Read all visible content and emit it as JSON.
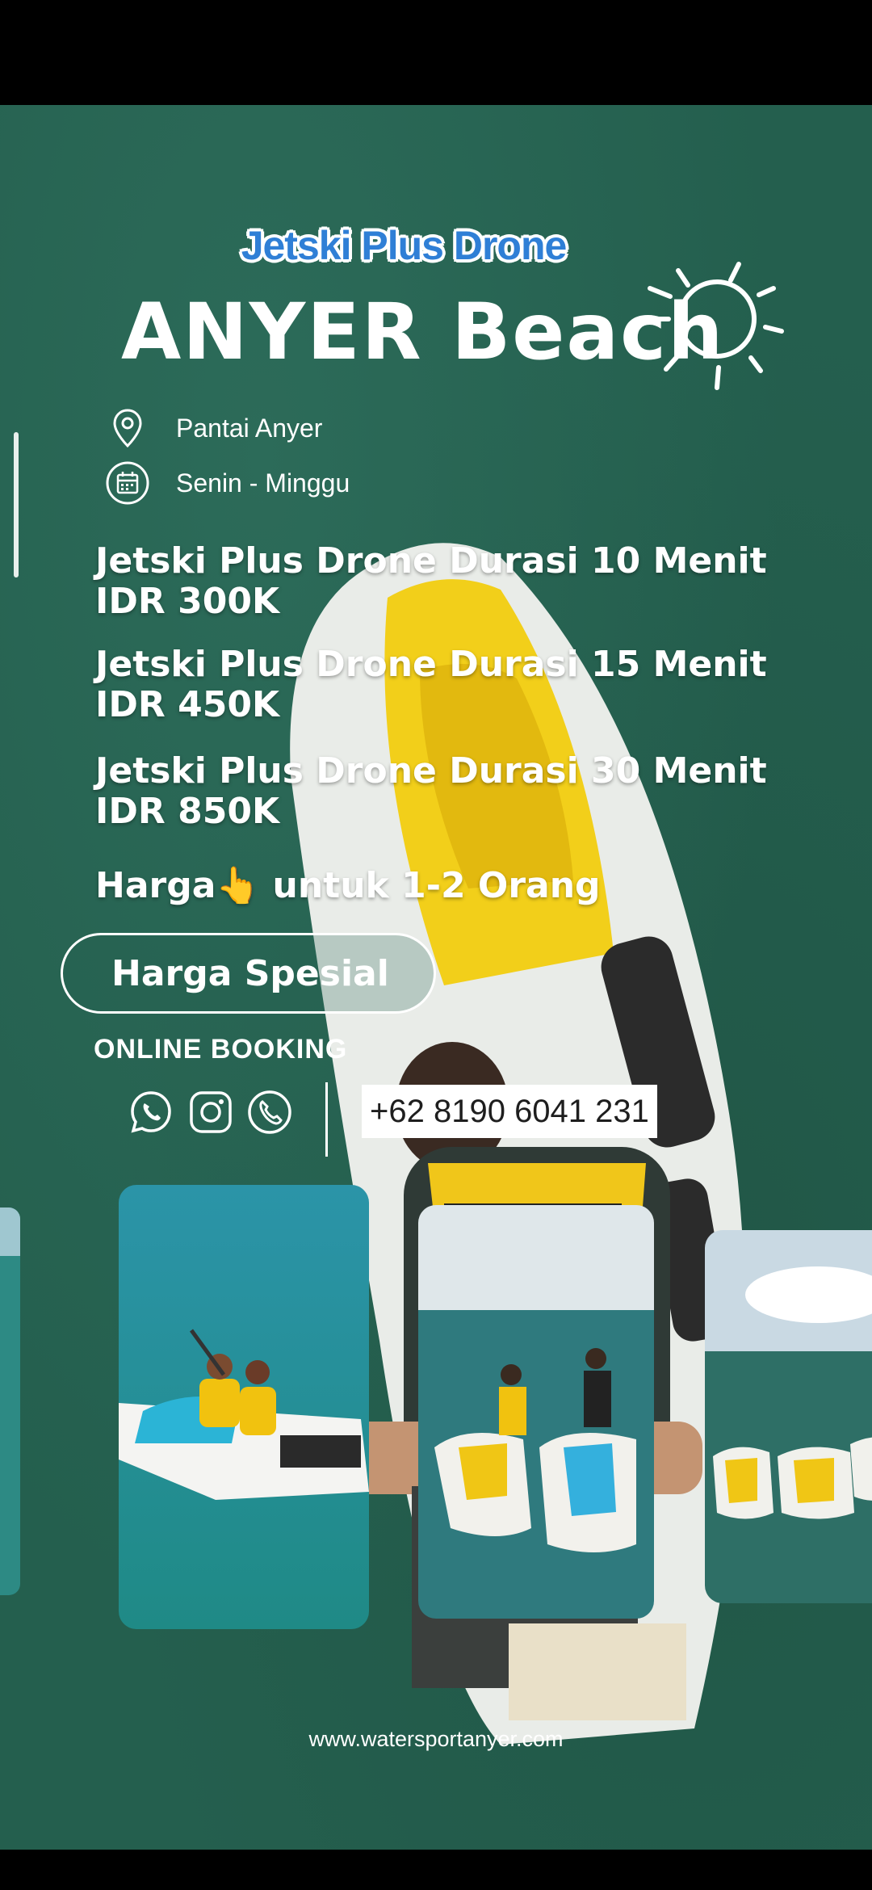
{
  "header": {
    "subtitle": "Jetski Plus Drone",
    "title": "ANYER Beach"
  },
  "info": {
    "location": "Pantai Anyer",
    "schedule": "Senin - Minggu"
  },
  "prices": [
    {
      "name": "Jetski Plus Drone Durasi 10 Menit",
      "value": "IDR 300K"
    },
    {
      "name": "Jetski Plus Drone Durasi 15 Menit",
      "value": "IDR 450K"
    },
    {
      "name": "Jetski Plus Drone Durasi 30 Menit",
      "value": "IDR 850K"
    }
  ],
  "note": {
    "before": "Harga",
    "hand": "👆",
    "after": " untuk 1-2 Orang"
  },
  "special_button": "Harga Spesial",
  "booking": {
    "label": "ONLINE BOOKING",
    "icons": [
      "whatsapp-icon",
      "instagram-icon",
      "phone-icon"
    ],
    "phone": "+62 8190 6041 231"
  },
  "website": "www.watersportanyer.com",
  "colors": {
    "background": "#245f4e",
    "title_accent": "#2f7fd6",
    "jetski_yellow": "#f2cf1a"
  }
}
